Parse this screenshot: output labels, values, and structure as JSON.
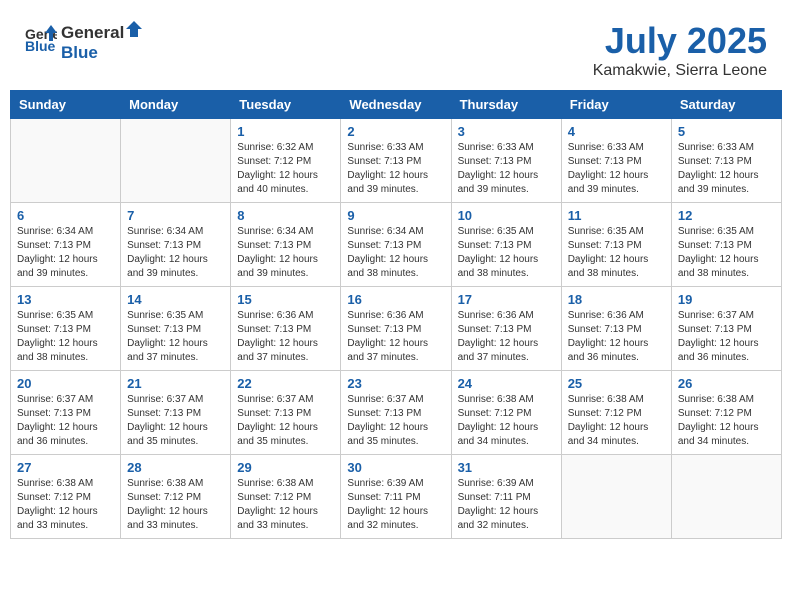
{
  "header": {
    "logo_general": "General",
    "logo_blue": "Blue",
    "month": "July 2025",
    "location": "Kamakwie, Sierra Leone"
  },
  "days_of_week": [
    "Sunday",
    "Monday",
    "Tuesday",
    "Wednesday",
    "Thursday",
    "Friday",
    "Saturday"
  ],
  "weeks": [
    [
      {
        "day": "",
        "info": ""
      },
      {
        "day": "",
        "info": ""
      },
      {
        "day": "1",
        "info": "Sunrise: 6:32 AM\nSunset: 7:12 PM\nDaylight: 12 hours\nand 40 minutes."
      },
      {
        "day": "2",
        "info": "Sunrise: 6:33 AM\nSunset: 7:13 PM\nDaylight: 12 hours\nand 39 minutes."
      },
      {
        "day": "3",
        "info": "Sunrise: 6:33 AM\nSunset: 7:13 PM\nDaylight: 12 hours\nand 39 minutes."
      },
      {
        "day": "4",
        "info": "Sunrise: 6:33 AM\nSunset: 7:13 PM\nDaylight: 12 hours\nand 39 minutes."
      },
      {
        "day": "5",
        "info": "Sunrise: 6:33 AM\nSunset: 7:13 PM\nDaylight: 12 hours\nand 39 minutes."
      }
    ],
    [
      {
        "day": "6",
        "info": "Sunrise: 6:34 AM\nSunset: 7:13 PM\nDaylight: 12 hours\nand 39 minutes."
      },
      {
        "day": "7",
        "info": "Sunrise: 6:34 AM\nSunset: 7:13 PM\nDaylight: 12 hours\nand 39 minutes."
      },
      {
        "day": "8",
        "info": "Sunrise: 6:34 AM\nSunset: 7:13 PM\nDaylight: 12 hours\nand 39 minutes."
      },
      {
        "day": "9",
        "info": "Sunrise: 6:34 AM\nSunset: 7:13 PM\nDaylight: 12 hours\nand 38 minutes."
      },
      {
        "day": "10",
        "info": "Sunrise: 6:35 AM\nSunset: 7:13 PM\nDaylight: 12 hours\nand 38 minutes."
      },
      {
        "day": "11",
        "info": "Sunrise: 6:35 AM\nSunset: 7:13 PM\nDaylight: 12 hours\nand 38 minutes."
      },
      {
        "day": "12",
        "info": "Sunrise: 6:35 AM\nSunset: 7:13 PM\nDaylight: 12 hours\nand 38 minutes."
      }
    ],
    [
      {
        "day": "13",
        "info": "Sunrise: 6:35 AM\nSunset: 7:13 PM\nDaylight: 12 hours\nand 38 minutes."
      },
      {
        "day": "14",
        "info": "Sunrise: 6:35 AM\nSunset: 7:13 PM\nDaylight: 12 hours\nand 37 minutes."
      },
      {
        "day": "15",
        "info": "Sunrise: 6:36 AM\nSunset: 7:13 PM\nDaylight: 12 hours\nand 37 minutes."
      },
      {
        "day": "16",
        "info": "Sunrise: 6:36 AM\nSunset: 7:13 PM\nDaylight: 12 hours\nand 37 minutes."
      },
      {
        "day": "17",
        "info": "Sunrise: 6:36 AM\nSunset: 7:13 PM\nDaylight: 12 hours\nand 37 minutes."
      },
      {
        "day": "18",
        "info": "Sunrise: 6:36 AM\nSunset: 7:13 PM\nDaylight: 12 hours\nand 36 minutes."
      },
      {
        "day": "19",
        "info": "Sunrise: 6:37 AM\nSunset: 7:13 PM\nDaylight: 12 hours\nand 36 minutes."
      }
    ],
    [
      {
        "day": "20",
        "info": "Sunrise: 6:37 AM\nSunset: 7:13 PM\nDaylight: 12 hours\nand 36 minutes."
      },
      {
        "day": "21",
        "info": "Sunrise: 6:37 AM\nSunset: 7:13 PM\nDaylight: 12 hours\nand 35 minutes."
      },
      {
        "day": "22",
        "info": "Sunrise: 6:37 AM\nSunset: 7:13 PM\nDaylight: 12 hours\nand 35 minutes."
      },
      {
        "day": "23",
        "info": "Sunrise: 6:37 AM\nSunset: 7:13 PM\nDaylight: 12 hours\nand 35 minutes."
      },
      {
        "day": "24",
        "info": "Sunrise: 6:38 AM\nSunset: 7:12 PM\nDaylight: 12 hours\nand 34 minutes."
      },
      {
        "day": "25",
        "info": "Sunrise: 6:38 AM\nSunset: 7:12 PM\nDaylight: 12 hours\nand 34 minutes."
      },
      {
        "day": "26",
        "info": "Sunrise: 6:38 AM\nSunset: 7:12 PM\nDaylight: 12 hours\nand 34 minutes."
      }
    ],
    [
      {
        "day": "27",
        "info": "Sunrise: 6:38 AM\nSunset: 7:12 PM\nDaylight: 12 hours\nand 33 minutes."
      },
      {
        "day": "28",
        "info": "Sunrise: 6:38 AM\nSunset: 7:12 PM\nDaylight: 12 hours\nand 33 minutes."
      },
      {
        "day": "29",
        "info": "Sunrise: 6:38 AM\nSunset: 7:12 PM\nDaylight: 12 hours\nand 33 minutes."
      },
      {
        "day": "30",
        "info": "Sunrise: 6:39 AM\nSunset: 7:11 PM\nDaylight: 12 hours\nand 32 minutes."
      },
      {
        "day": "31",
        "info": "Sunrise: 6:39 AM\nSunset: 7:11 PM\nDaylight: 12 hours\nand 32 minutes."
      },
      {
        "day": "",
        "info": ""
      },
      {
        "day": "",
        "info": ""
      }
    ]
  ]
}
